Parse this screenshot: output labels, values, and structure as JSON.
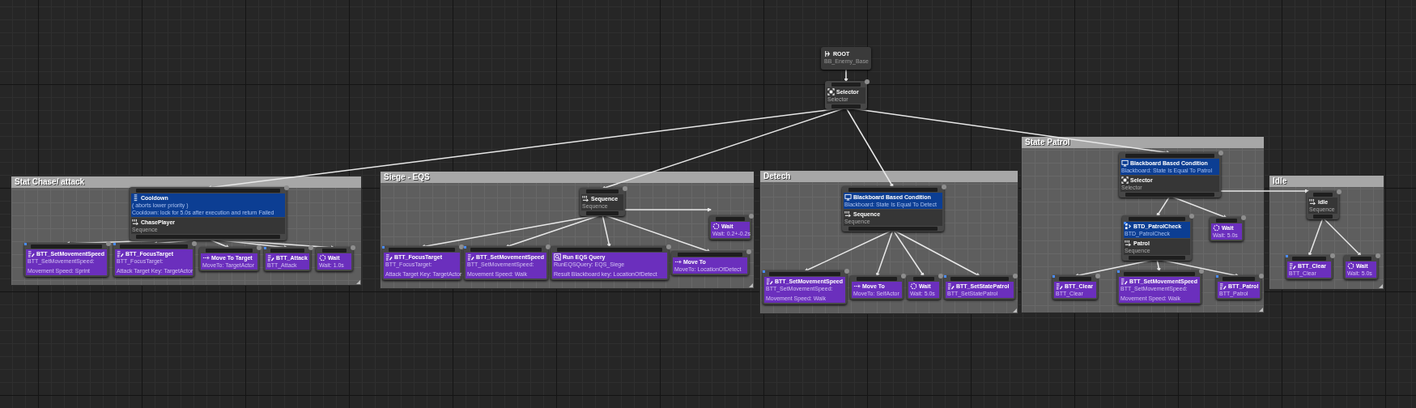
{
  "comments": [
    {
      "title": "Stat Chase/ attack"
    },
    {
      "title": "Siege - EQS"
    },
    {
      "title": "Detech"
    },
    {
      "title": "State Patrol"
    },
    {
      "title": "Idle"
    }
  ],
  "tree": {
    "kind": "root",
    "blueprint": false,
    "title": "ROOT",
    "lines": [
      "BB_Enemy_Base"
    ],
    "children": [
      {
        "kind": "selector",
        "blueprint": false,
        "title": "Selector",
        "lines": [
          "Selector"
        ],
        "children": [
          {
            "kind": "sequence",
            "blueprint": false,
            "decorators": [
              {
                "kind": "cooldown",
                "blueprint": false,
                "title": "Cooldown",
                "lines": [
                  "( aborts lower priority )",
                  "Cooldown: lock for 5.0s after execution and return Failed"
                ]
              }
            ],
            "title": "ChasePlayer",
            "lines": [
              "Sequence"
            ],
            "children": [
              {
                "kind": "task",
                "blueprint": true,
                "title": "BTT_SetMovementSpeed",
                "lines": [
                  "BTT_SetMovementSpeed:",
                  "Movement Speed: Sprint"
                ]
              },
              {
                "kind": "task",
                "blueprint": true,
                "title": "BTT_FocusTarget",
                "lines": [
                  "BTT_FocusTarget:",
                  "Attack Target Key: TargetActor"
                ]
              },
              {
                "kind": "move_to",
                "blueprint": false,
                "title": "Move To Target",
                "lines": [
                  "MoveTo: TargetActor"
                ]
              },
              {
                "kind": "task",
                "blueprint": true,
                "title": "BTT_Attack",
                "lines": [
                  "BTT_Attack"
                ]
              },
              {
                "kind": "wait",
                "blueprint": false,
                "title": "Wait",
                "lines": [
                  "Wait: 1.0s"
                ]
              }
            ]
          },
          {
            "kind": "sequence",
            "blueprint": false,
            "title": "Sequence",
            "lines": [
              "Sequence"
            ],
            "children": [
              {
                "kind": "task",
                "blueprint": true,
                "title": "BTT_FocusTarget",
                "lines": [
                  "BTT_FocusTarget:",
                  "Attack Target Key: TargetActor"
                ]
              },
              {
                "kind": "task",
                "blueprint": true,
                "title": "BTT_SetMovementSpeed",
                "lines": [
                  "BTT_SetMovementSpeed:",
                  "Movement Speed: Walk"
                ]
              },
              {
                "kind": "eqs",
                "blueprint": false,
                "title": "Run EQS Query",
                "lines": [
                  "RunEQSQuery: EQS_Siege",
                  "Result Blackboard key: LocationOfDetect"
                ]
              },
              {
                "kind": "wait",
                "blueprint": false,
                "title": "Wait",
                "lines": [
                  "Wait: 0.2+-0.2s"
                ]
              },
              {
                "kind": "move_to",
                "blueprint": false,
                "title": "Move To",
                "lines": [
                  "MoveTo: LocationOfDetect"
                ]
              }
            ]
          },
          {
            "kind": "sequence",
            "blueprint": false,
            "decorators": [
              {
                "kind": "blackboard",
                "blueprint": false,
                "title": "Blackboard Based Condition",
                "lines": [
                  "Blackboard: State Is Equal To Detect"
                ]
              }
            ],
            "title": "Sequence",
            "lines": [
              "Sequence"
            ],
            "children": [
              {
                "kind": "task",
                "blueprint": true,
                "title": "BTT_SetMovementSpeed",
                "lines": [
                  "BTT_SetMovementSpeed:",
                  "Movement Speed: Walk"
                ]
              },
              {
                "kind": "move_to",
                "blueprint": false,
                "title": "Move To",
                "lines": [
                  "MoveTo: SelfActor"
                ]
              },
              {
                "kind": "wait",
                "blueprint": false,
                "title": "Wait",
                "lines": [
                  "Wait: 5.0s"
                ]
              },
              {
                "kind": "task",
                "blueprint": true,
                "title": "BTT_SetStatePatrol",
                "lines": [
                  "BTT_SetStatePatrol"
                ]
              }
            ]
          },
          {
            "kind": "selector",
            "blueprint": false,
            "decorators": [
              {
                "kind": "blackboard",
                "blueprint": false,
                "title": "Blackboard Based Condition",
                "lines": [
                  "Blackboard: State Is Equal To Patrol"
                ]
              }
            ],
            "title": "Selector",
            "lines": [
              "Selector"
            ],
            "children": [
              {
                "kind": "sequence",
                "blueprint": false,
                "decorators": [
                  {
                    "kind": "custom",
                    "blueprint": true,
                    "title": "BTD_PatrolCheck",
                    "lines": [
                      "BTD_PatrolCheck"
                    ]
                  }
                ],
                "title": "Patrol",
                "lines": [
                  "Sequence"
                ],
                "children": [
                  {
                    "kind": "task",
                    "blueprint": true,
                    "title": "BTT_Clear",
                    "lines": [
                      "BTT_Clear"
                    ]
                  },
                  {
                    "kind": "task",
                    "blueprint": true,
                    "title": "BTT_SetMovementSpeed",
                    "lines": [
                      "BTT_SetMovementSpeed:",
                      "Movement Speed: Walk"
                    ]
                  },
                  {
                    "kind": "task",
                    "blueprint": true,
                    "title": "BTT_Patrol",
                    "lines": [
                      "BTT_Patrol"
                    ]
                  }
                ]
              },
              {
                "kind": "wait",
                "blueprint": false,
                "title": "Wait",
                "lines": [
                  "Wait: 5.0s"
                ]
              },
              {
                "kind": "sequence",
                "blueprint": false,
                "title": "idle",
                "lines": [
                  "Sequence"
                ],
                "children": [
                  {
                    "kind": "task",
                    "blueprint": true,
                    "title": "BTT_Clear",
                    "lines": [
                      "BTT_Clear"
                    ]
                  },
                  {
                    "kind": "wait",
                    "blueprint": false,
                    "title": "Wait",
                    "lines": [
                      "Wait: 5.0s"
                    ]
                  }
                ]
              }
            ]
          }
        ]
      }
    ]
  }
}
